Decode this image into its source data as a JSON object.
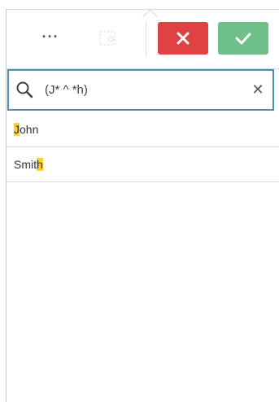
{
  "toolbar": {
    "more_label": "···",
    "more_icon": "more-options-icon",
    "disabled_icon": "selection-tool-icon",
    "cancel_icon": "close-icon",
    "confirm_icon": "checkmark-icon",
    "colors": {
      "cancel": "#e04142",
      "confirm": "#6ec088"
    }
  },
  "search": {
    "value": "(J* ^ *h)",
    "placeholder": "",
    "icon": "search-icon",
    "clear_label": "✕",
    "border_color": "#4a8fb0"
  },
  "list": {
    "highlight_color": "#ffcf26",
    "items": [
      {
        "highlight": "J",
        "rest": "ohn",
        "before": ""
      },
      {
        "before": "Smit",
        "highlight": "h",
        "rest": ""
      }
    ]
  }
}
